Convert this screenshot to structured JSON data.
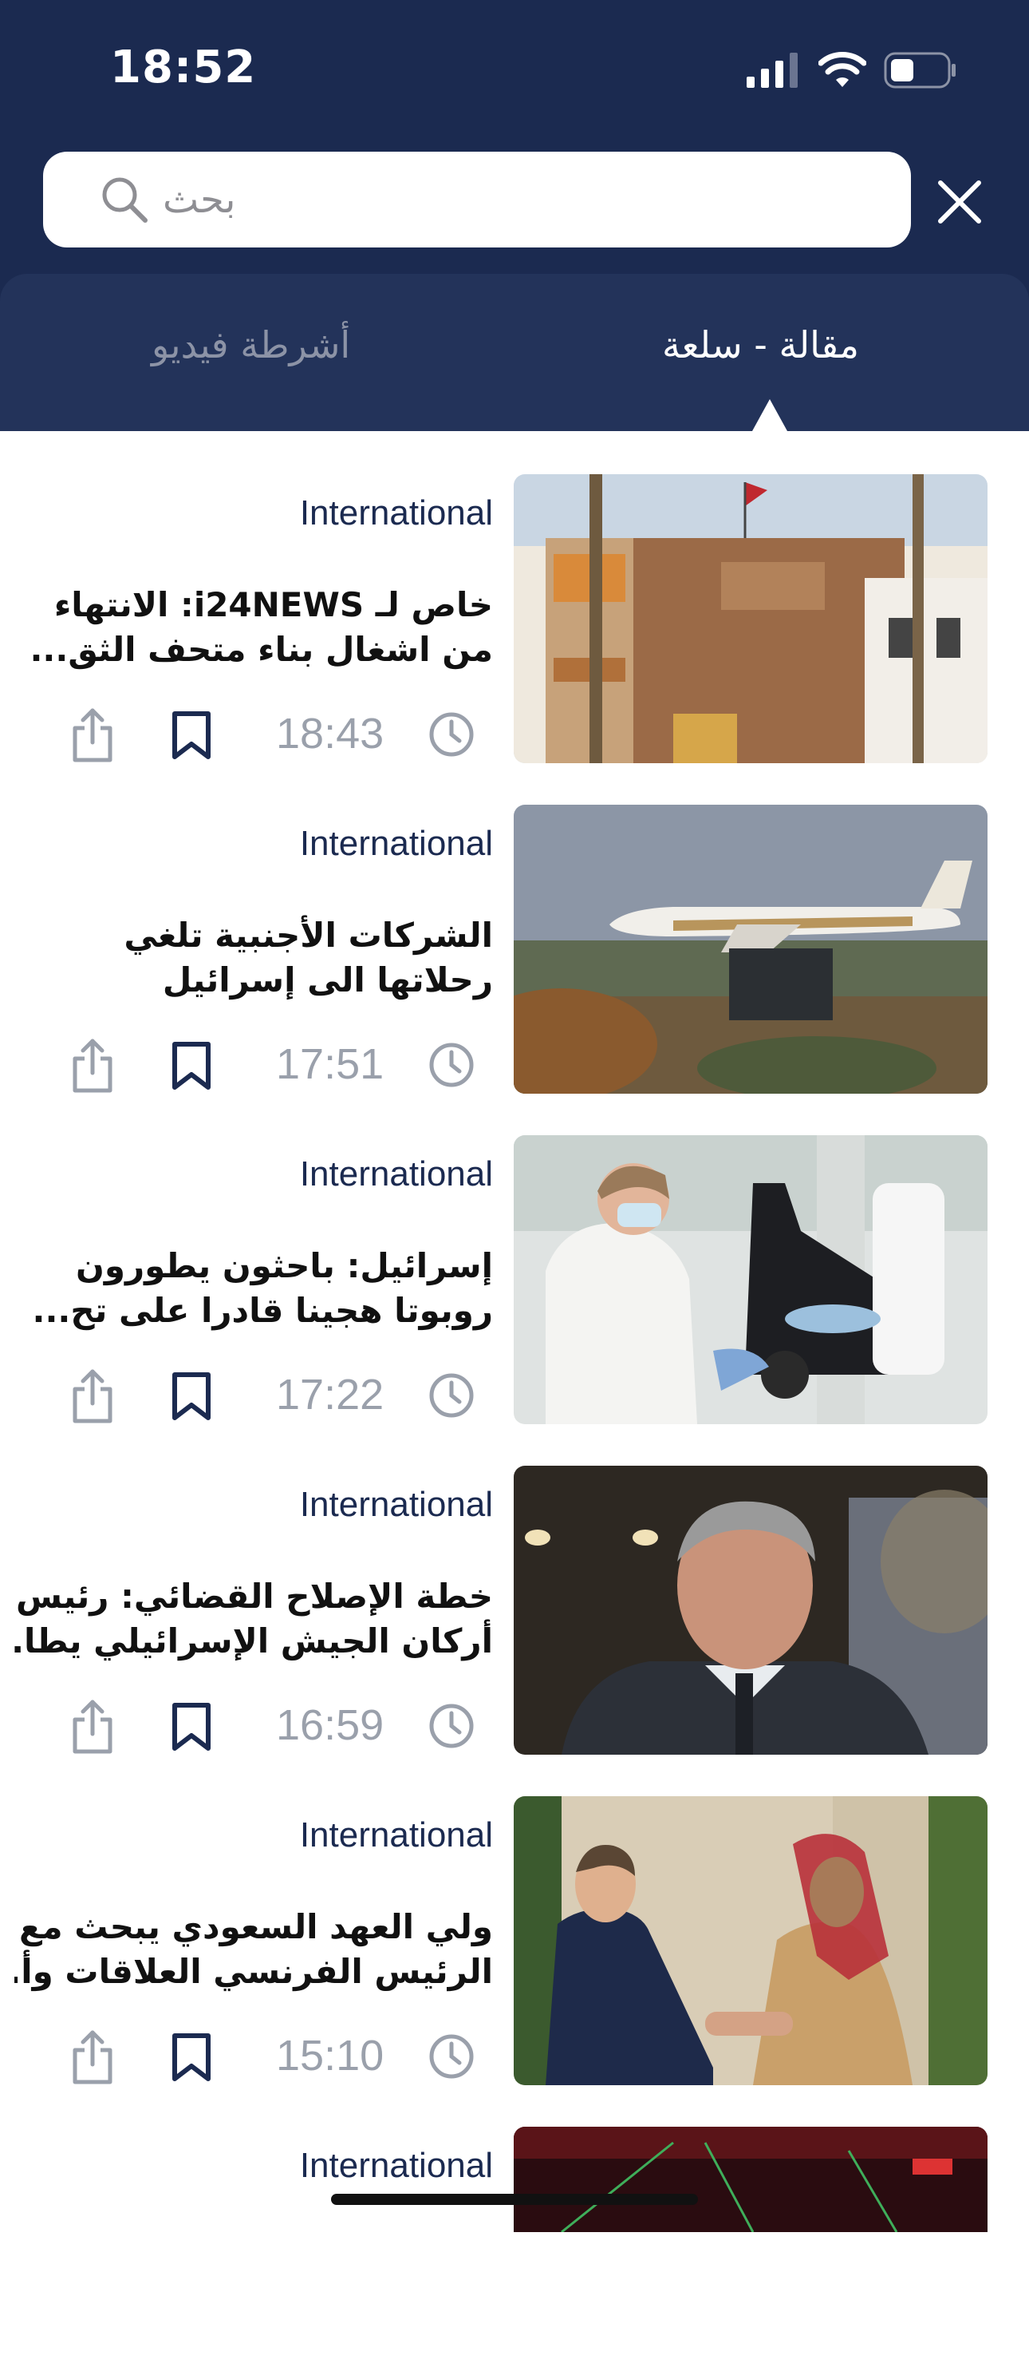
{
  "status_bar": {
    "time": "18:52"
  },
  "search": {
    "placeholder": "بحث"
  },
  "tabs": [
    {
      "label": "مقالة - سلعة",
      "active": true
    },
    {
      "label": "أشرطة فيديو",
      "active": false
    }
  ],
  "articles": [
    {
      "category": "International",
      "title_line1": "خاص لـ i24NEWS: الانتهاء",
      "title_line2": "من اشغال بناء متحف الثق...",
      "time": "18:43",
      "image": "museum-building"
    },
    {
      "category": "International",
      "title_line1": "الشركات الأجنبية تلغي",
      "title_line2": "رحلاتها الى إسرائيل",
      "time": "17:51",
      "image": "etihad-airplane"
    },
    {
      "category": "International",
      "title_line1": "إسرائيل: باحثون يطورون",
      "title_line2": "روبوتا هجينا قادرا على تح...",
      "time": "17:22",
      "image": "lab-microscope"
    },
    {
      "category": "International",
      "title_line1": "خطة الإصلاح القضائي: رئيس",
      "title_line2": "أركان الجيش الإسرائيلي يطا...",
      "time": "16:59",
      "image": "army-chief-portrait"
    },
    {
      "category": "International",
      "title_line1": "ولي العهد السعودي يبحث مع",
      "title_line2": "الرئيس الفرنسي العلاقات وأ...",
      "time": "15:10",
      "image": "leaders-handshake"
    },
    {
      "category": "International",
      "title_line1": "",
      "title_line2": "",
      "time": "",
      "image": "stadium-lights"
    }
  ],
  "colors": {
    "header_bg": "#1b2a50",
    "tabs_bg": "#23335a",
    "category_text": "#1b2a50",
    "time_text": "#9aa0ab"
  }
}
